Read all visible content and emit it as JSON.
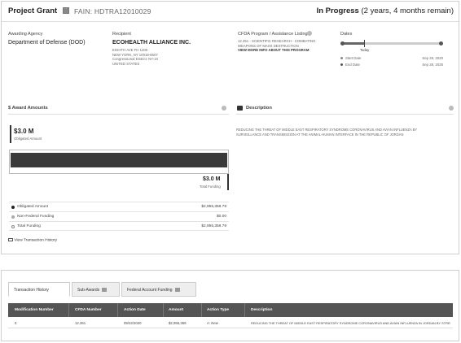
{
  "header": {
    "title": "Project Grant",
    "fain": "FAIN: HDTRA12010029",
    "status_main": "In Progress",
    "status_detail": "(2 years, 4 months remain)"
  },
  "agency": {
    "label": "Awarding Agency",
    "name": "Department of Defense (DOD)"
  },
  "recipient": {
    "label": "Recipient",
    "name": "ECOHEALTH ALLIANCE INC.",
    "address": [
      "EIGHTH AVE FH 1200",
      "NEW YORK, NY 10018-6507",
      "Congressional District: NY-10",
      "UNITED STATES"
    ]
  },
  "cfda": {
    "label": "CFDA Program / Assistance Listing",
    "line1": "12.351 - SCIENTIFIC RESEARCH - COMBATING",
    "line2": "WEAPONS OF MASS DESTRUCTION",
    "link": "VIEW MORE INFO ABOUT THIS PROGRAM"
  },
  "dates": {
    "label": "Dates",
    "today": "Today",
    "progress": 0.22,
    "start_label": "Start Date",
    "start_value": "Sep 29, 2020",
    "end_label": "End Date",
    "end_value": "Sep 28, 2025"
  },
  "award": {
    "title": "$ Award Amounts",
    "obligated_big": "$3.0 M",
    "obligated_caption": "Obligated Amount",
    "total_big": "$3.0 M",
    "total_caption": "Total Funding",
    "rows": [
      {
        "label": "Obligated Amount",
        "value": "$2,955,358.79",
        "color": "#222"
      },
      {
        "label": "Non-Federal Funding",
        "value": "$0.00",
        "color": "#aaa"
      },
      {
        "label": "Total Funding",
        "value": "$2,955,358.79",
        "color": "#fff"
      }
    ],
    "history_link": "View Transaction History"
  },
  "description": {
    "title": "Description",
    "text1": "REDUCING THE THREAT OF MIDDLE EAST RESPIRATORY SYNDROME CORONAVIRUS AND AVIAN INFLUENZA BY",
    "text2": "SURVEILLANCE AND TRANSMISSION AT THE ANIMAL-HUMAN INTERFACE IN THE REPUBLIC OF JORDAN"
  },
  "bottom": {
    "tabs": [
      {
        "label": "Transaction History",
        "active": true
      },
      {
        "label": "Sub-Awards",
        "active": false
      },
      {
        "label": "Federal Account Funding",
        "active": false
      }
    ],
    "columns": [
      "Modification Number",
      "CFDA Number",
      "Action Date",
      "Amount",
      "Action Type",
      "Description"
    ],
    "row": [
      "0",
      "12.351",
      "09/22/2020",
      "$2,955,359",
      "A: New",
      "REDUCING THE THREAT OF MIDDLE EAST RESPIRATORY SYNDROME CORONAVIRUS AND AVIAN INFLUENZA IN JORDAN BY STRENG..."
    ]
  }
}
